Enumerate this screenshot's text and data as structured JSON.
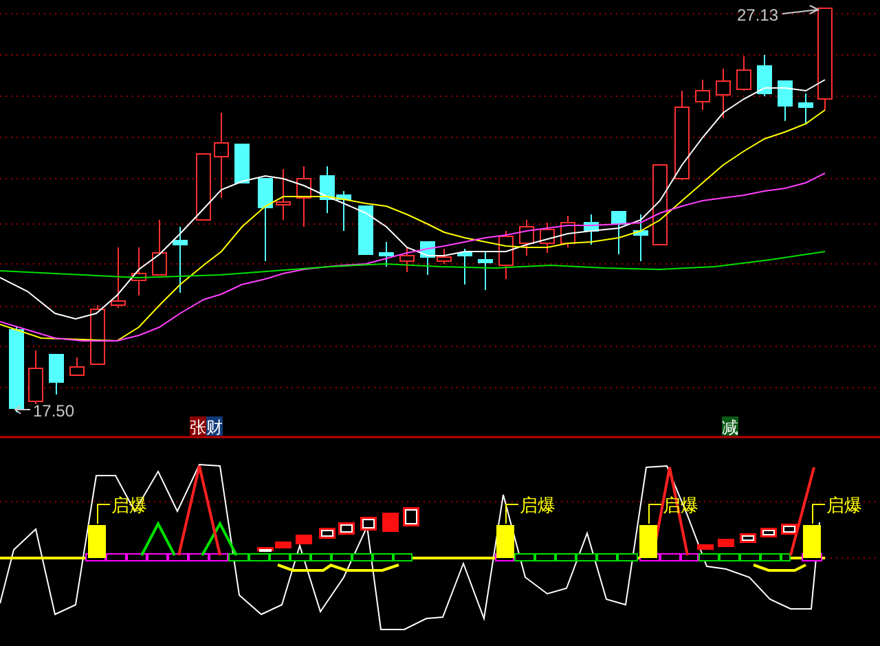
{
  "price_chart": {
    "high_label": "27.13",
    "low_label": "17.50"
  },
  "signal_tags": [
    {
      "text": "张",
      "color": "#8b0000"
    },
    {
      "text": "财",
      "color": "#123a7a"
    },
    {
      "text": "减",
      "color": "#0b5a16"
    }
  ],
  "indicator": {
    "markers": [
      {
        "text": "启爆"
      },
      {
        "text": "启爆"
      },
      {
        "text": "启爆"
      },
      {
        "text": "启爆"
      }
    ]
  }
}
